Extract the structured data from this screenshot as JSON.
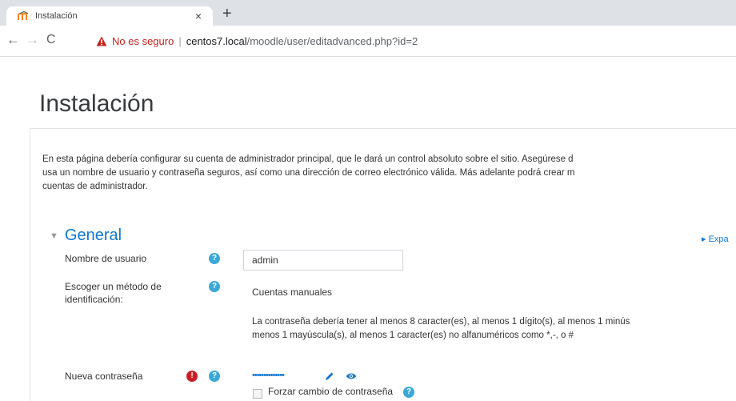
{
  "browser": {
    "tab_title": "Instalación",
    "tab_close": "×",
    "new_tab": "+",
    "security_label": "No es seguro",
    "separator": "|",
    "url_host": "centos7.local",
    "url_path": "/moodle/user/editadvanced.php?id=2"
  },
  "page": {
    "title": "Instalación",
    "intro_lines": [
      "En esta página debería configurar su cuenta de administrador principal, que le dará un control absoluto sobre el sitio. Asegúrese d",
      "usa un nombre de usuario y contraseña seguros, así como una dirección de correo electrónico válida. Más adelante podrá crear m",
      "cuentas de administrador."
    ],
    "expand_all": "▸ Expa"
  },
  "form": {
    "section_title": "General",
    "username_label": "Nombre de usuario",
    "username_value": "admin",
    "auth_label_lines": [
      "Escoger un método de",
      "identificación:"
    ],
    "auth_value": "Cuentas manuales",
    "password_policy_lines": [
      "La contraseña debería tener al menos 8 caracter(es), al menos 1 dígito(s), al menos 1 minús",
      "menos 1 mayúscula(s), al menos 1 caracter(es) no alfanuméricos como *,-, o #"
    ],
    "new_password_label": "Nueva contraseña",
    "password_mask": "••••••••••••••",
    "force_change_label": "Forzar cambio de contraseña"
  },
  "colors": {
    "link_blue": "#1177d1",
    "help_icon": "#3aa8d8",
    "required_icon": "#ca1f26",
    "insecure_red": "#c5221f"
  },
  "icons": [
    "moodle-favicon",
    "back-arrow-icon",
    "forward-arrow-icon",
    "reload-icon",
    "warning-icon",
    "help-icon",
    "required-icon",
    "pencil-icon",
    "eye-icon"
  ]
}
